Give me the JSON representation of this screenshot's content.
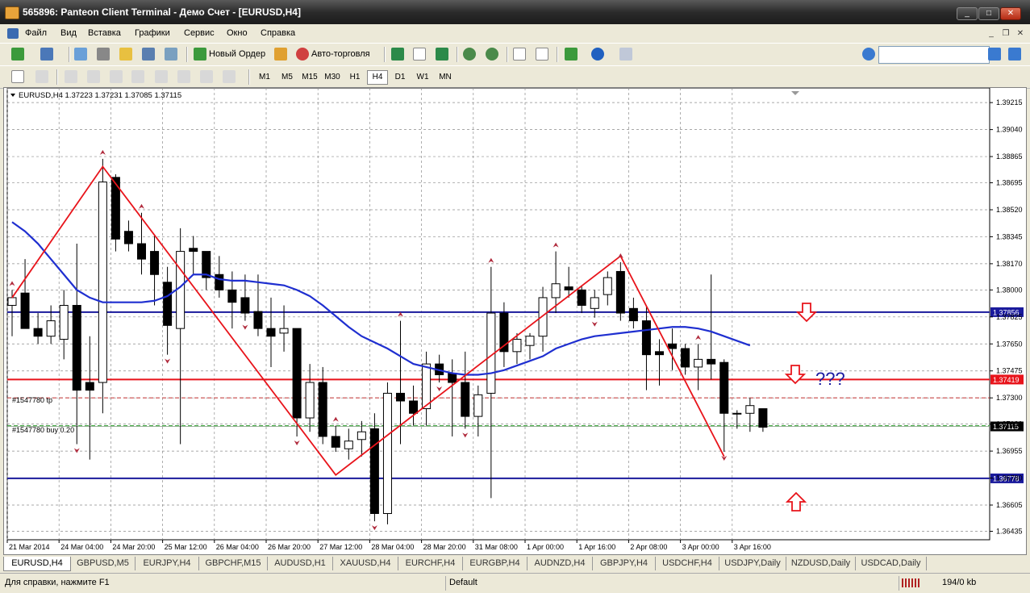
{
  "window": {
    "title": "565896: Panteon Client Terminal - Демо Счет - [EURUSD,H4]"
  },
  "window_buttons": {
    "minimize": "_",
    "maximize": "□",
    "close": "✕"
  },
  "menu": [
    "Файл",
    "Вид",
    "Вставка",
    "Графики",
    "Сервис",
    "Окно",
    "Справка"
  ],
  "mdi_buttons": {
    "minimize": "_",
    "restore": "❐",
    "close": "✕"
  },
  "toolbar": {
    "new_order": "Новый Ордер",
    "auto_trading": "Авто-торговля",
    "search_placeholder": ""
  },
  "timeframes": [
    "M1",
    "M5",
    "M15",
    "M30",
    "H1",
    "H4",
    "D1",
    "W1",
    "MN"
  ],
  "active_timeframe": "H4",
  "symbol_tabs": [
    "EURUSD,H4",
    "GBPUSD,M5",
    "EURJPY,H4",
    "GBPCHF,M15",
    "AUDUSD,H1",
    "XAUUSD,H4",
    "EURCHF,H4",
    "EURGBP,H4",
    "AUDNZD,H4",
    "GBPJPY,H4",
    "USDCHF,H4",
    "USDJPY,Daily",
    "NZDUSD,Daily",
    "USDCAD,Daily"
  ],
  "status": {
    "help": "Для справки, нажмите F1",
    "profile": "Default",
    "traffic": "194/0 kb"
  },
  "colors": {
    "bull_candle": "#ffffff",
    "bear_candle": "#000000",
    "zigzag": "#e8141b",
    "moving_average": "#1f2fd0",
    "level_blue": "#1a1a9c",
    "level_red": "#e8141b",
    "grid": "#8c8c8c"
  },
  "chart_data": {
    "type": "candlestick",
    "symbol_header": "EURUSD,H4  1.37223 1.37231 1.37085 1.37115",
    "price_axis": {
      "ticks": [
        "1.39215",
        "1.39040",
        "1.38865",
        "1.38695",
        "1.38520",
        "1.38345",
        "1.38170",
        "1.38000",
        "1.37825",
        "1.37650",
        "1.37475",
        "1.37300",
        "1.37130",
        "1.36955",
        "1.36780",
        "1.36605",
        "1.36435"
      ],
      "range": [
        1.3638,
        1.3931
      ]
    },
    "time_axis": [
      "21 Mar 2014",
      "24 Mar 04:00",
      "24 Mar 20:00",
      "25 Mar 12:00",
      "26 Mar 04:00",
      "26 Mar 20:00",
      "27 Mar 12:00",
      "28 Mar 04:00",
      "28 Mar 20:00",
      "31 Mar 08:00",
      "1 Apr 00:00",
      "1 Apr 16:00",
      "2 Apr 08:00",
      "3 Apr 00:00",
      "3 Apr 16:00"
    ],
    "candles": [
      {
        "o": 1.379,
        "h": 1.38,
        "l": 1.377,
        "c": 1.3795
      },
      {
        "o": 1.3798,
        "h": 1.382,
        "l": 1.378,
        "c": 1.3775
      },
      {
        "o": 1.3775,
        "h": 1.3785,
        "l": 1.3765,
        "c": 1.377
      },
      {
        "o": 1.377,
        "h": 1.379,
        "l": 1.3765,
        "c": 1.378
      },
      {
        "o": 1.3768,
        "h": 1.38,
        "l": 1.3755,
        "c": 1.379
      },
      {
        "o": 1.379,
        "h": 1.383,
        "l": 1.37,
        "c": 1.3735
      },
      {
        "o": 1.374,
        "h": 1.377,
        "l": 1.369,
        "c": 1.3735
      },
      {
        "o": 1.374,
        "h": 1.3885,
        "l": 1.372,
        "c": 1.387
      },
      {
        "o": 1.3873,
        "h": 1.3875,
        "l": 1.3825,
        "c": 1.3833
      },
      {
        "o": 1.3838,
        "h": 1.3845,
        "l": 1.3825,
        "c": 1.383
      },
      {
        "o": 1.383,
        "h": 1.385,
        "l": 1.381,
        "c": 1.382
      },
      {
        "o": 1.3825,
        "h": 1.3835,
        "l": 1.379,
        "c": 1.381
      },
      {
        "o": 1.3805,
        "h": 1.3815,
        "l": 1.3758,
        "c": 1.3777
      },
      {
        "o": 1.3775,
        "h": 1.384,
        "l": 1.37,
        "c": 1.3825
      },
      {
        "o": 1.3827,
        "h": 1.3835,
        "l": 1.381,
        "c": 1.3825
      },
      {
        "o": 1.3825,
        "h": 1.3825,
        "l": 1.38,
        "c": 1.3808
      },
      {
        "o": 1.381,
        "h": 1.3822,
        "l": 1.3795,
        "c": 1.38
      },
      {
        "o": 1.38,
        "h": 1.3812,
        "l": 1.3775,
        "c": 1.3792
      },
      {
        "o": 1.3795,
        "h": 1.381,
        "l": 1.378,
        "c": 1.3785
      },
      {
        "o": 1.3786,
        "h": 1.381,
        "l": 1.377,
        "c": 1.3775
      },
      {
        "o": 1.3775,
        "h": 1.3795,
        "l": 1.375,
        "c": 1.377
      },
      {
        "o": 1.3772,
        "h": 1.379,
        "l": 1.376,
        "c": 1.3775
      },
      {
        "o": 1.3775,
        "h": 1.3775,
        "l": 1.3705,
        "c": 1.3717
      },
      {
        "o": 1.3717,
        "h": 1.3752,
        "l": 1.3708,
        "c": 1.374
      },
      {
        "o": 1.374,
        "h": 1.375,
        "l": 1.37,
        "c": 1.3705
      },
      {
        "o": 1.3705,
        "h": 1.3712,
        "l": 1.3695,
        "c": 1.3698
      },
      {
        "o": 1.3697,
        "h": 1.371,
        "l": 1.369,
        "c": 1.3702
      },
      {
        "o": 1.3703,
        "h": 1.3715,
        "l": 1.3692,
        "c": 1.3708
      },
      {
        "o": 1.371,
        "h": 1.372,
        "l": 1.365,
        "c": 1.3655
      },
      {
        "o": 1.3655,
        "h": 1.374,
        "l": 1.3648,
        "c": 1.3733
      },
      {
        "o": 1.3733,
        "h": 1.378,
        "l": 1.37,
        "c": 1.3728
      },
      {
        "o": 1.3728,
        "h": 1.3738,
        "l": 1.3712,
        "c": 1.372
      },
      {
        "o": 1.3723,
        "h": 1.376,
        "l": 1.3712,
        "c": 1.3752
      },
      {
        "o": 1.3752,
        "h": 1.3758,
        "l": 1.374,
        "c": 1.3745
      },
      {
        "o": 1.3746,
        "h": 1.3755,
        "l": 1.3705,
        "c": 1.374
      },
      {
        "o": 1.374,
        "h": 1.376,
        "l": 1.371,
        "c": 1.3718
      },
      {
        "o": 1.3718,
        "h": 1.3738,
        "l": 1.3705,
        "c": 1.3732
      },
      {
        "o": 1.3733,
        "h": 1.3815,
        "l": 1.3665,
        "c": 1.3785
      },
      {
        "o": 1.3785,
        "h": 1.3792,
        "l": 1.375,
        "c": 1.376
      },
      {
        "o": 1.376,
        "h": 1.3772,
        "l": 1.3752,
        "c": 1.3768
      },
      {
        "o": 1.3764,
        "h": 1.3772,
        "l": 1.3755,
        "c": 1.377
      },
      {
        "o": 1.377,
        "h": 1.3802,
        "l": 1.376,
        "c": 1.3795
      },
      {
        "o": 1.3795,
        "h": 1.3825,
        "l": 1.3785,
        "c": 1.3804
      },
      {
        "o": 1.3802,
        "h": 1.3815,
        "l": 1.3795,
        "c": 1.38
      },
      {
        "o": 1.38,
        "h": 1.3803,
        "l": 1.3785,
        "c": 1.379
      },
      {
        "o": 1.3788,
        "h": 1.38,
        "l": 1.3782,
        "c": 1.3795
      },
      {
        "o": 1.3797,
        "h": 1.3812,
        "l": 1.379,
        "c": 1.3808
      },
      {
        "o": 1.3812,
        "h": 1.3818,
        "l": 1.378,
        "c": 1.3785
      },
      {
        "o": 1.3788,
        "h": 1.3795,
        "l": 1.3775,
        "c": 1.378
      },
      {
        "o": 1.378,
        "h": 1.379,
        "l": 1.3735,
        "c": 1.3758
      },
      {
        "o": 1.376,
        "h": 1.3768,
        "l": 1.3738,
        "c": 1.3758
      },
      {
        "o": 1.3765,
        "h": 1.3775,
        "l": 1.3748,
        "c": 1.3762
      },
      {
        "o": 1.3762,
        "h": 1.3765,
        "l": 1.3745,
        "c": 1.375
      },
      {
        "o": 1.375,
        "h": 1.3765,
        "l": 1.3735,
        "c": 1.3755
      },
      {
        "o": 1.3755,
        "h": 1.381,
        "l": 1.3742,
        "c": 1.3752
      },
      {
        "o": 1.3753,
        "h": 1.3755,
        "l": 1.3695,
        "c": 1.372
      },
      {
        "o": 1.372,
        "h": 1.3722,
        "l": 1.371,
        "c": 1.372
      },
      {
        "o": 1.372,
        "h": 1.373,
        "l": 1.3708,
        "c": 1.3725
      },
      {
        "o": 1.3723,
        "h": 1.3723,
        "l": 1.3708,
        "c": 1.3711
      }
    ],
    "moving_average": [
      1.3844,
      1.3838,
      1.383,
      1.382,
      1.381,
      1.38,
      1.3795,
      1.3792,
      1.3792,
      1.3792,
      1.3792,
      1.3793,
      1.3796,
      1.3802,
      1.381,
      1.381,
      1.3807,
      1.3806,
      1.3806,
      1.3805,
      1.3804,
      1.3803,
      1.38,
      1.3796,
      1.379,
      1.3783,
      1.3776,
      1.377,
      1.3766,
      1.3762,
      1.3757,
      1.3752,
      1.375,
      1.3748,
      1.3746,
      1.3745,
      1.3745,
      1.3746,
      1.3748,
      1.3751,
      1.3754,
      1.3757,
      1.3762,
      1.3765,
      1.3768,
      1.377,
      1.3771,
      1.3772,
      1.3773,
      1.3774,
      1.3775,
      1.3776,
      1.3776,
      1.3775,
      1.3773,
      1.377,
      1.3767,
      1.3764
    ],
    "zigzag": [
      {
        "i": 0,
        "p": 1.3795
      },
      {
        "i": 7,
        "p": 1.388
      },
      {
        "i": 25,
        "p": 1.368
      },
      {
        "i": 47,
        "p": 1.3822
      },
      {
        "i": 55,
        "p": 1.3692
      }
    ],
    "horizontal_lines": [
      {
        "price": 1.37856,
        "label": "1.37856",
        "color": "#1a1a9c"
      },
      {
        "price": 1.37419,
        "label": "1.37419",
        "color": "#e8141b"
      },
      {
        "price": 1.36778,
        "label": "1.36778",
        "color": "#1a1a9c"
      }
    ],
    "order_lines": [
      {
        "price": 1.373,
        "label": "#1547780 tp",
        "color": "#c03030"
      },
      {
        "price": 1.3712,
        "label": "#1547780 buy 0.20",
        "color": "#30a030"
      }
    ],
    "current_price": {
      "price": 1.37115,
      "label": "1.37115"
    },
    "fractal_up_index": [
      0,
      7,
      10,
      25,
      30,
      37,
      42,
      47,
      53
    ],
    "fractal_down_index": [
      5,
      12,
      18,
      22,
      28,
      33,
      35,
      45,
      55
    ],
    "annotation": "???"
  }
}
